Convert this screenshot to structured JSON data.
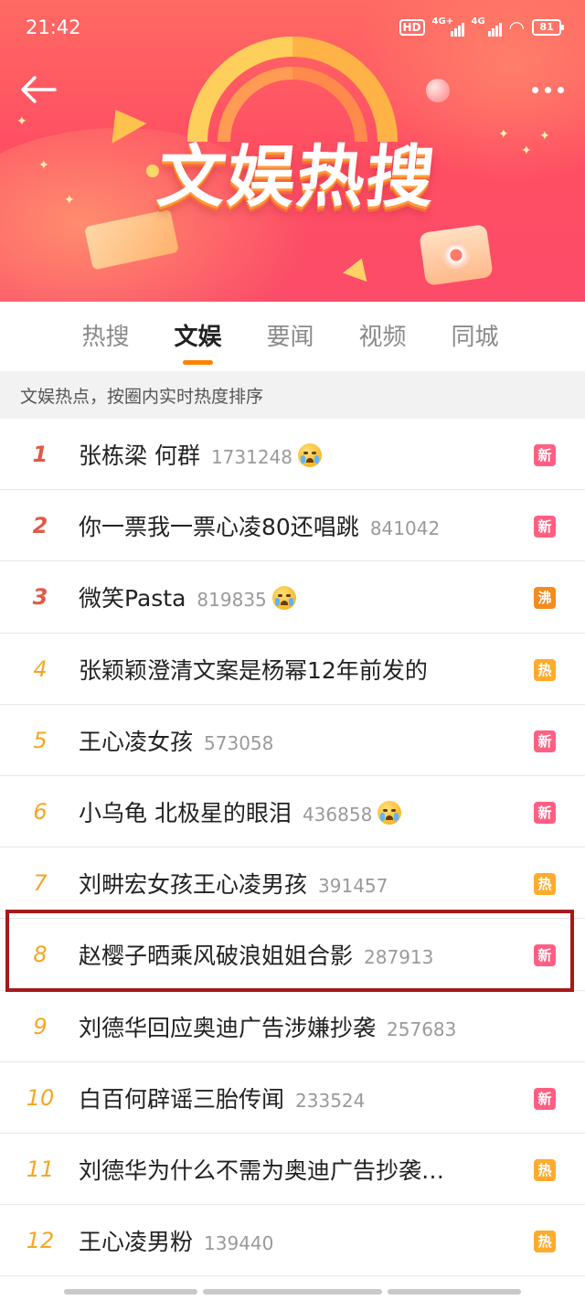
{
  "status_bar": {
    "time": "21:42",
    "hd": "HD",
    "signal1": "4G+",
    "signal2": "4G",
    "battery": "81"
  },
  "header": {
    "banner_title": "文娱热搜",
    "back_icon": "back-arrow-icon",
    "more_icon": "more-dots-icon"
  },
  "tabs": [
    {
      "label": "热搜"
    },
    {
      "label": "文娱"
    },
    {
      "label": "要闻"
    },
    {
      "label": "视频"
    },
    {
      "label": "同城"
    }
  ],
  "active_tab": "文娱",
  "subheader": "文娱热点，按圈内实时热度排序",
  "items": [
    {
      "rank": "1",
      "title": "张栋梁 何群",
      "heat": "1731248",
      "emoji": true,
      "badge": "新",
      "badge_type": "new"
    },
    {
      "rank": "2",
      "title": "你一票我一票心凌80还唱跳",
      "heat": "841042",
      "emoji": false,
      "badge": "新",
      "badge_type": "new"
    },
    {
      "rank": "3",
      "title": "微笑Pasta",
      "heat": "819835",
      "emoji": true,
      "badge": "沸",
      "badge_type": "boil"
    },
    {
      "rank": "4",
      "title": "张颖颖澄清文案是杨幂12年前发的",
      "heat": "",
      "emoji": false,
      "badge": "热",
      "badge_type": "hot"
    },
    {
      "rank": "5",
      "title": "王心凌女孩",
      "heat": "573058",
      "emoji": false,
      "badge": "新",
      "badge_type": "new"
    },
    {
      "rank": "6",
      "title": "小乌龟 北极星的眼泪",
      "heat": "436858",
      "emoji": true,
      "badge": "新",
      "badge_type": "new"
    },
    {
      "rank": "7",
      "title": "刘畊宏女孩王心凌男孩",
      "heat": "391457",
      "emoji": false,
      "badge": "热",
      "badge_type": "hot"
    },
    {
      "rank": "8",
      "title": "赵樱子晒乘风破浪姐姐合影",
      "heat": "287913",
      "emoji": false,
      "badge": "新",
      "badge_type": "new"
    },
    {
      "rank": "9",
      "title": "刘德华回应奥迪广告涉嫌抄袭",
      "heat": "257683",
      "emoji": false,
      "badge": "",
      "badge_type": ""
    },
    {
      "rank": "10",
      "title": "白百何辟谣三胎传闻",
      "heat": "233524",
      "emoji": false,
      "badge": "新",
      "badge_type": "new"
    },
    {
      "rank": "11",
      "title": "刘德华为什么不需为奥迪广告抄袭…",
      "heat": "",
      "emoji": false,
      "badge": "热",
      "badge_type": "hot"
    },
    {
      "rank": "12",
      "title": "王心凌男粉",
      "heat": "139440",
      "emoji": false,
      "badge": "热",
      "badge_type": "hot"
    }
  ],
  "colors": {
    "accent": "#ff8200",
    "rank_top": "#e05a48",
    "rank_normal": "#f5a623",
    "badge_new": "#ff5f83",
    "badge_hot": "#ffab2d",
    "badge_boil": "#f58a1f",
    "highlight_border": "#a61a1a"
  }
}
